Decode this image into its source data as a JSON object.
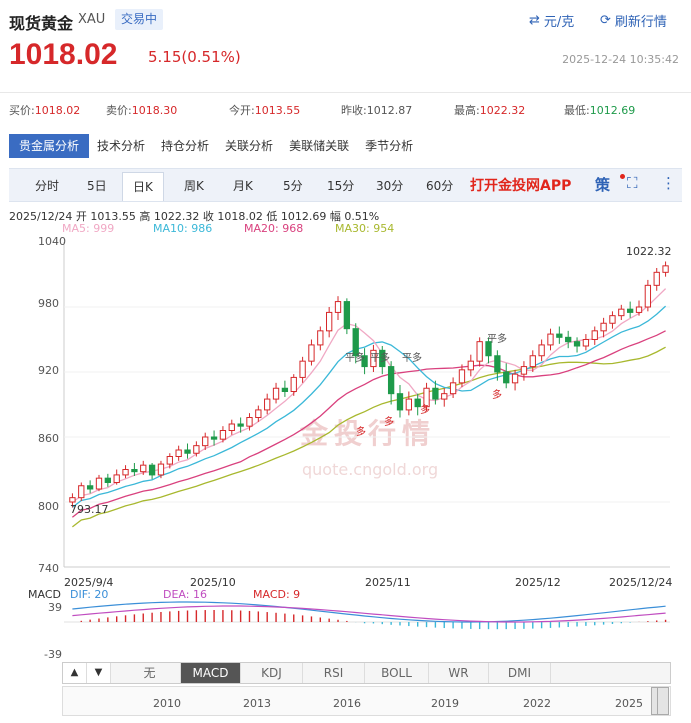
{
  "header": {
    "name": "现货黄金",
    "symbol": "XAU",
    "status_badge": "交易中",
    "unit_button": "元/克",
    "refresh_button": "刷新行情",
    "price": "1018.02",
    "change": "5.15(0.51%)",
    "timestamp": "2025-12-24 10:35:42",
    "price_color": "#d6282a",
    "down_color": "#1e9a4a"
  },
  "quotes": [
    {
      "label": "买价:",
      "value": "1018.02",
      "color": "#d6282a"
    },
    {
      "label": "卖价:",
      "value": "1018.30",
      "color": "#d6282a"
    },
    {
      "label": "今开:",
      "value": "1013.55",
      "color": "#d6282a"
    },
    {
      "label": "昨收:",
      "value": "1012.87",
      "color": "#333333"
    },
    {
      "label": "最高:",
      "value": "1022.32",
      "color": "#d6282a"
    },
    {
      "label": "最低:",
      "value": "1012.69",
      "color": "#1e9a4a"
    }
  ],
  "analysis_tabs": [
    "贵金属分析",
    "技术分析",
    "持仓分析",
    "关联分析",
    "美联储关联",
    "季节分析"
  ],
  "period_tabs": [
    "分时",
    "5日",
    "日K",
    "周K",
    "月K",
    "5分",
    "15分",
    "30分",
    "60分"
  ],
  "period_active": "日K",
  "app_link": "打开金投网APP",
  "strategy_label": "策",
  "info_line": "2025/12/24  开 1013.55  高 1022.32  收 1018.02  低 1012.69  幅 0.51%",
  "ma_legend": [
    {
      "label": "MA5: 999",
      "color": "#f0a8c4"
    },
    {
      "label": "MA10: 986",
      "color": "#3bb8d8"
    },
    {
      "label": "MA20: 968",
      "color": "#d9417e"
    },
    {
      "label": "MA30: 954",
      "color": "#a8b82e"
    }
  ],
  "watermark": {
    "brand": "金投行情",
    "url": "quote.cngold.org"
  },
  "chart_data": {
    "type": "candlestick",
    "y_ticks": [
      "1040",
      "980",
      "920",
      "860",
      "800",
      "740"
    ],
    "ylim": [
      740,
      1040
    ],
    "x_ticks": [
      "2025/9/4",
      "2025/10",
      "2025/11",
      "2025/12",
      "2025/12/24"
    ],
    "annotations": {
      "max": "1022.32",
      "min": "793.17",
      "markers": [
        "平多",
        "平多",
        "平多",
        "平多",
        "多",
        "多",
        "多",
        "多"
      ]
    },
    "candles": [
      [
        800,
        804,
        808,
        795
      ],
      [
        804,
        815,
        818,
        801
      ],
      [
        815,
        812,
        820,
        808
      ],
      [
        812,
        822,
        825,
        810
      ],
      [
        822,
        818,
        826,
        814
      ],
      [
        818,
        825,
        830,
        816
      ],
      [
        825,
        830,
        834,
        822
      ],
      [
        830,
        828,
        836,
        824
      ],
      [
        828,
        834,
        838,
        825
      ],
      [
        834,
        825,
        836,
        821
      ],
      [
        825,
        835,
        838,
        822
      ],
      [
        835,
        842,
        845,
        831
      ],
      [
        842,
        848,
        852,
        838
      ],
      [
        848,
        845,
        854,
        840
      ],
      [
        845,
        852,
        856,
        842
      ],
      [
        852,
        860,
        864,
        848
      ],
      [
        860,
        858,
        866,
        852
      ],
      [
        858,
        866,
        870,
        855
      ],
      [
        866,
        872,
        876,
        862
      ],
      [
        872,
        870,
        878,
        864
      ],
      [
        870,
        878,
        882,
        866
      ],
      [
        878,
        885,
        889,
        874
      ],
      [
        885,
        895,
        900,
        881
      ],
      [
        895,
        905,
        910,
        891
      ],
      [
        905,
        902,
        912,
        897
      ],
      [
        902,
        915,
        918,
        898
      ],
      [
        915,
        930,
        934,
        910
      ],
      [
        930,
        945,
        950,
        926
      ],
      [
        945,
        958,
        962,
        940
      ],
      [
        958,
        975,
        980,
        952
      ],
      [
        975,
        985,
        990,
        968
      ],
      [
        985,
        960,
        988,
        955
      ],
      [
        960,
        935,
        965,
        928
      ],
      [
        935,
        925,
        942,
        918
      ],
      [
        925,
        940,
        945,
        920
      ],
      [
        940,
        925,
        944,
        918
      ],
      [
        925,
        900,
        930,
        890
      ],
      [
        900,
        885,
        908,
        878
      ],
      [
        885,
        895,
        902,
        880
      ],
      [
        895,
        888,
        900,
        880
      ],
      [
        888,
        905,
        910,
        884
      ],
      [
        905,
        895,
        912,
        890
      ],
      [
        895,
        900,
        905,
        888
      ],
      [
        900,
        910,
        915,
        896
      ],
      [
        910,
        922,
        927,
        906
      ],
      [
        922,
        930,
        936,
        916
      ],
      [
        930,
        948,
        952,
        925
      ],
      [
        948,
        935,
        952,
        928
      ],
      [
        935,
        920,
        940,
        912
      ],
      [
        920,
        910,
        928,
        905
      ],
      [
        910,
        918,
        922,
        903
      ],
      [
        918,
        925,
        930,
        912
      ],
      [
        925,
        935,
        940,
        920
      ],
      [
        935,
        945,
        950,
        930
      ],
      [
        945,
        955,
        960,
        940
      ],
      [
        955,
        952,
        962,
        946
      ],
      [
        952,
        948,
        958,
        942
      ],
      [
        948,
        944,
        952,
        938
      ],
      [
        944,
        950,
        955,
        940
      ],
      [
        950,
        958,
        962,
        945
      ],
      [
        958,
        965,
        970,
        952
      ],
      [
        965,
        972,
        976,
        960
      ],
      [
        972,
        978,
        982,
        968
      ],
      [
        978,
        975,
        985,
        970
      ],
      [
        975,
        980,
        986,
        972
      ],
      [
        980,
        1000,
        1005,
        976
      ],
      [
        1000,
        1012,
        1016,
        995
      ],
      [
        1012,
        1018,
        1022,
        1008
      ]
    ]
  },
  "macd": {
    "labels": [
      {
        "label": "MACD",
        "color": "#333333"
      },
      {
        "label": "DIF: 20",
        "color": "#3b8fd8"
      },
      {
        "label": "DEA: 16",
        "color": "#c04dc0"
      },
      {
        "label": "MACD: 9",
        "color": "#d6282a"
      }
    ],
    "y_ticks": [
      "39",
      "-39"
    ]
  },
  "indicator_tabs": [
    "无",
    "MACD",
    "KDJ",
    "RSI",
    "BOLL",
    "WR",
    "DMI"
  ],
  "indicator_active": "MACD",
  "nav_years": [
    "2010",
    "2013",
    "2016",
    "2019",
    "2022",
    "2025"
  ]
}
